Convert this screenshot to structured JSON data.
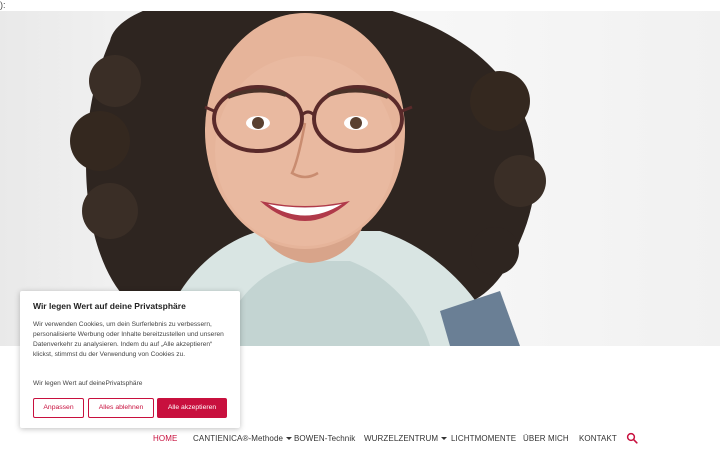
{
  "page": {
    "stray_text": "):"
  },
  "hero": {
    "alt": "Portrait of a smiling woman with curly dark hair and glasses"
  },
  "cookie_banner": {
    "title": "Wir legen Wert auf deine Privatsphäre",
    "body": "Wir verwenden Cookies, um dein Surferlebnis zu verbessern, personalisierte Werbung oder Inhalte bereitzustellen und unseren Datenverkehr zu analysieren. Indem du auf „Alle akzeptieren“ klickst, stimmst du der Verwendung von Cookies zu.",
    "privacy_link": "Wir legen Wert auf deinePrivatsphäre",
    "buttons": {
      "customize": "Anpassen",
      "reject_all": "Alles ablehnen",
      "accept_all": "Alle akzeptieren"
    }
  },
  "nav": {
    "items": [
      {
        "label": "HOME",
        "active": true
      },
      {
        "label": "CANTIENICA®-Methode",
        "dropdown": true
      },
      {
        "label": "BOWEN-Technik"
      },
      {
        "label": "WURZELZENTRUM",
        "dropdown": true
      },
      {
        "label": "LICHTMOMENTE"
      },
      {
        "label": "ÜBER MICH"
      },
      {
        "label": "KONTAKT"
      }
    ],
    "search_icon": "search-icon"
  },
  "colors": {
    "accent": "#c8103e",
    "text": "#333333",
    "background": "#ffffff"
  }
}
